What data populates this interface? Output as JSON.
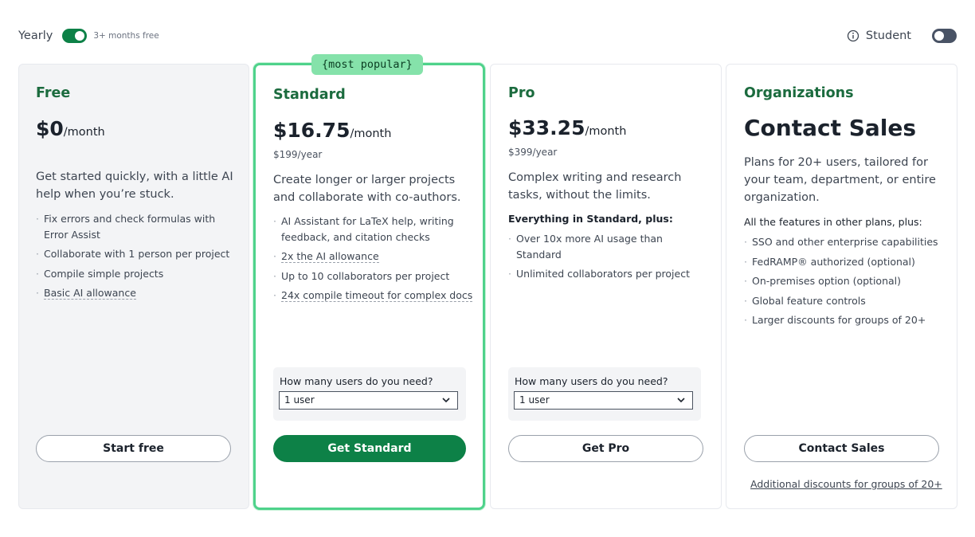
{
  "topbar": {
    "yearly_label": "Yearly",
    "yearly_toggle_on": true,
    "months_free": "3+ months free",
    "student_label": "Student",
    "student_toggle_on": false
  },
  "colors": {
    "brand_green": "#0d8147",
    "accent_green": "#4fd28b",
    "badge_green": "#85e2aa",
    "plan_name_green": "#1b6b3e"
  },
  "plans": {
    "free": {
      "name": "Free",
      "price": "$0",
      "per": "/month",
      "description": "Get started quickly, with a little AI help when you’re stuck.",
      "features": [
        "Fix errors and check formulas with Error Assist",
        "Collaborate with 1 person per project",
        "Compile simple projects",
        "Basic AI allowance"
      ],
      "button": "Start free"
    },
    "standard": {
      "badge": "{most popular}",
      "name": "Standard",
      "price": "$16.75",
      "per": "/month",
      "per_year": "$199/year",
      "description": "Create longer or larger projects and collaborate with co-authors.",
      "features": [
        "AI Assistant for LaTeX help, writing feedback, and citation checks",
        "2x the AI allowance",
        "Up to 10 collaborators per project",
        "24x compile timeout for complex docs"
      ],
      "users_label": "How many users do you need?",
      "users_value": "1 user",
      "button": "Get Standard"
    },
    "pro": {
      "name": "Pro",
      "price": "$33.25",
      "per": "/month",
      "per_year": "$399/year",
      "description": "Complex writing and research tasks, without the limits.",
      "sub_head": "Everything in Standard, plus:",
      "features": [
        "Over 10x more AI usage than Standard",
        "Unlimited collaborators per project"
      ],
      "users_label": "How many users do you need?",
      "users_value": "1 user",
      "button": "Get Pro"
    },
    "organizations": {
      "name": "Organizations",
      "title": "Contact Sales",
      "description": "Plans for 20+ users, tailored for your team, department, or entire organization.",
      "sub_head": "All the features in other plans, plus:",
      "features": [
        "SSO and other enterprise capabilities",
        "FedRAMP® authorized (optional)",
        "On-premises option (optional)",
        "Global feature controls",
        "Larger discounts for groups of 20+"
      ],
      "button": "Contact Sales",
      "link": "Additional discounts for groups of 20+"
    }
  }
}
